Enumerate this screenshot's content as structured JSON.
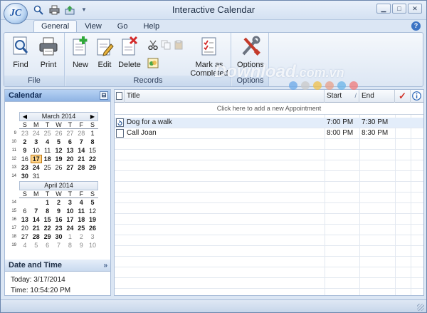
{
  "app": {
    "logo_text": "JC",
    "title": "Interactive Calendar",
    "tabs": [
      "General",
      "View",
      "Go",
      "Help"
    ],
    "active_tab": "General"
  },
  "ribbon": {
    "groups": {
      "file": "File",
      "records": "Records",
      "options": "Options"
    },
    "buttons": {
      "find": "Find",
      "print": "Print",
      "new": "New",
      "edit": "Edit",
      "delete": "Delete",
      "mark_completed_1": "Mark as",
      "mark_completed_2": "Completed",
      "options": "Options"
    }
  },
  "watermark": {
    "text_main": "Download",
    "text_domain": ".com.vn",
    "dot_colors": [
      "#6aa8e8",
      "#c9c9c9",
      "#f0c04a",
      "#e8a08a",
      "#6ab4e8",
      "#f07a7a"
    ]
  },
  "calendar": {
    "header": "Calendar",
    "dow": [
      "S",
      "M",
      "T",
      "W",
      "T",
      "F",
      "S"
    ],
    "months": [
      {
        "title": "March 2014",
        "weeks": [
          {
            "wk": "9",
            "days": [
              {
                "d": "23",
                "s": "gray"
              },
              {
                "d": "24",
                "s": "gray"
              },
              {
                "d": "25",
                "s": "gray"
              },
              {
                "d": "26",
                "s": "gray"
              },
              {
                "d": "27",
                "s": "gray"
              },
              {
                "d": "28",
                "s": "gray"
              },
              {
                "d": "1",
                "s": ""
              }
            ]
          },
          {
            "wk": "10",
            "days": [
              {
                "d": "2",
                "s": "bold"
              },
              {
                "d": "3",
                "s": "bold"
              },
              {
                "d": "4",
                "s": "bold"
              },
              {
                "d": "5",
                "s": "bold"
              },
              {
                "d": "6",
                "s": "bold"
              },
              {
                "d": "7",
                "s": "bold"
              },
              {
                "d": "8",
                "s": "bold"
              }
            ]
          },
          {
            "wk": "11",
            "days": [
              {
                "d": "9",
                "s": "bold"
              },
              {
                "d": "10",
                "s": ""
              },
              {
                "d": "11",
                "s": ""
              },
              {
                "d": "12",
                "s": "bold"
              },
              {
                "d": "13",
                "s": "bold"
              },
              {
                "d": "14",
                "s": "bold"
              },
              {
                "d": "15",
                "s": ""
              }
            ]
          },
          {
            "wk": "12",
            "days": [
              {
                "d": "16",
                "s": ""
              },
              {
                "d": "17",
                "s": "today"
              },
              {
                "d": "18",
                "s": "bold"
              },
              {
                "d": "19",
                "s": "bold"
              },
              {
                "d": "20",
                "s": "bold"
              },
              {
                "d": "21",
                "s": "bold"
              },
              {
                "d": "22",
                "s": "bold"
              }
            ]
          },
          {
            "wk": "13",
            "days": [
              {
                "d": "23",
                "s": "bold"
              },
              {
                "d": "24",
                "s": "bold"
              },
              {
                "d": "25",
                "s": ""
              },
              {
                "d": "26",
                "s": ""
              },
              {
                "d": "27",
                "s": "bold"
              },
              {
                "d": "28",
                "s": "bold"
              },
              {
                "d": "29",
                "s": "bold"
              }
            ]
          },
          {
            "wk": "14",
            "days": [
              {
                "d": "30",
                "s": "bold"
              },
              {
                "d": "31",
                "s": ""
              },
              {
                "d": "",
                "s": ""
              },
              {
                "d": "",
                "s": ""
              },
              {
                "d": "",
                "s": ""
              },
              {
                "d": "",
                "s": ""
              },
              {
                "d": "",
                "s": ""
              }
            ]
          }
        ]
      },
      {
        "title": "April 2014",
        "weeks": [
          {
            "wk": "14",
            "days": [
              {
                "d": "",
                "s": ""
              },
              {
                "d": "",
                "s": ""
              },
              {
                "d": "1",
                "s": "bold"
              },
              {
                "d": "2",
                "s": "bold"
              },
              {
                "d": "3",
                "s": "bold"
              },
              {
                "d": "4",
                "s": "bold"
              },
              {
                "d": "5",
                "s": "bold"
              }
            ]
          },
          {
            "wk": "15",
            "days": [
              {
                "d": "6",
                "s": ""
              },
              {
                "d": "7",
                "s": "bold"
              },
              {
                "d": "8",
                "s": "bold"
              },
              {
                "d": "9",
                "s": "bold"
              },
              {
                "d": "10",
                "s": "bold"
              },
              {
                "d": "11",
                "s": "bold"
              },
              {
                "d": "12",
                "s": ""
              }
            ]
          },
          {
            "wk": "16",
            "days": [
              {
                "d": "13",
                "s": "bold"
              },
              {
                "d": "14",
                "s": "bold"
              },
              {
                "d": "15",
                "s": "bold"
              },
              {
                "d": "16",
                "s": "bold"
              },
              {
                "d": "17",
                "s": "bold"
              },
              {
                "d": "18",
                "s": "bold"
              },
              {
                "d": "19",
                "s": "bold"
              }
            ]
          },
          {
            "wk": "17",
            "days": [
              {
                "d": "20",
                "s": ""
              },
              {
                "d": "21",
                "s": "bold"
              },
              {
                "d": "22",
                "s": "bold"
              },
              {
                "d": "23",
                "s": "bold"
              },
              {
                "d": "24",
                "s": "bold"
              },
              {
                "d": "25",
                "s": "bold"
              },
              {
                "d": "26",
                "s": "bold"
              }
            ]
          },
          {
            "wk": "18",
            "days": [
              {
                "d": "27",
                "s": ""
              },
              {
                "d": "28",
                "s": "bold"
              },
              {
                "d": "29",
                "s": "bold"
              },
              {
                "d": "30",
                "s": "bold"
              },
              {
                "d": "1",
                "s": "gray"
              },
              {
                "d": "2",
                "s": "gray"
              },
              {
                "d": "3",
                "s": "gray"
              }
            ]
          },
          {
            "wk": "19",
            "days": [
              {
                "d": "4",
                "s": "gray"
              },
              {
                "d": "5",
                "s": "gray"
              },
              {
                "d": "6",
                "s": "gray"
              },
              {
                "d": "7",
                "s": "gray"
              },
              {
                "d": "8",
                "s": "gray"
              },
              {
                "d": "9",
                "s": "gray"
              },
              {
                "d": "10",
                "s": "gray"
              }
            ]
          }
        ]
      }
    ]
  },
  "date_time": {
    "header": "Date and Time",
    "today": "Today: 3/17/2014",
    "time": "Time: 10:54:20 PM"
  },
  "appointments": {
    "columns": {
      "title": "Title",
      "start": "Start",
      "end": "End"
    },
    "add_prompt": "Click here to add a new Appointment",
    "rows": [
      {
        "title": "Dog for a walk",
        "start": "7:00 PM",
        "end": "7:30 PM",
        "selected": true
      },
      {
        "title": "Call Joan",
        "start": "8:00 PM",
        "end": "8:30 PM",
        "selected": false
      }
    ],
    "empty_row_count": 15
  }
}
